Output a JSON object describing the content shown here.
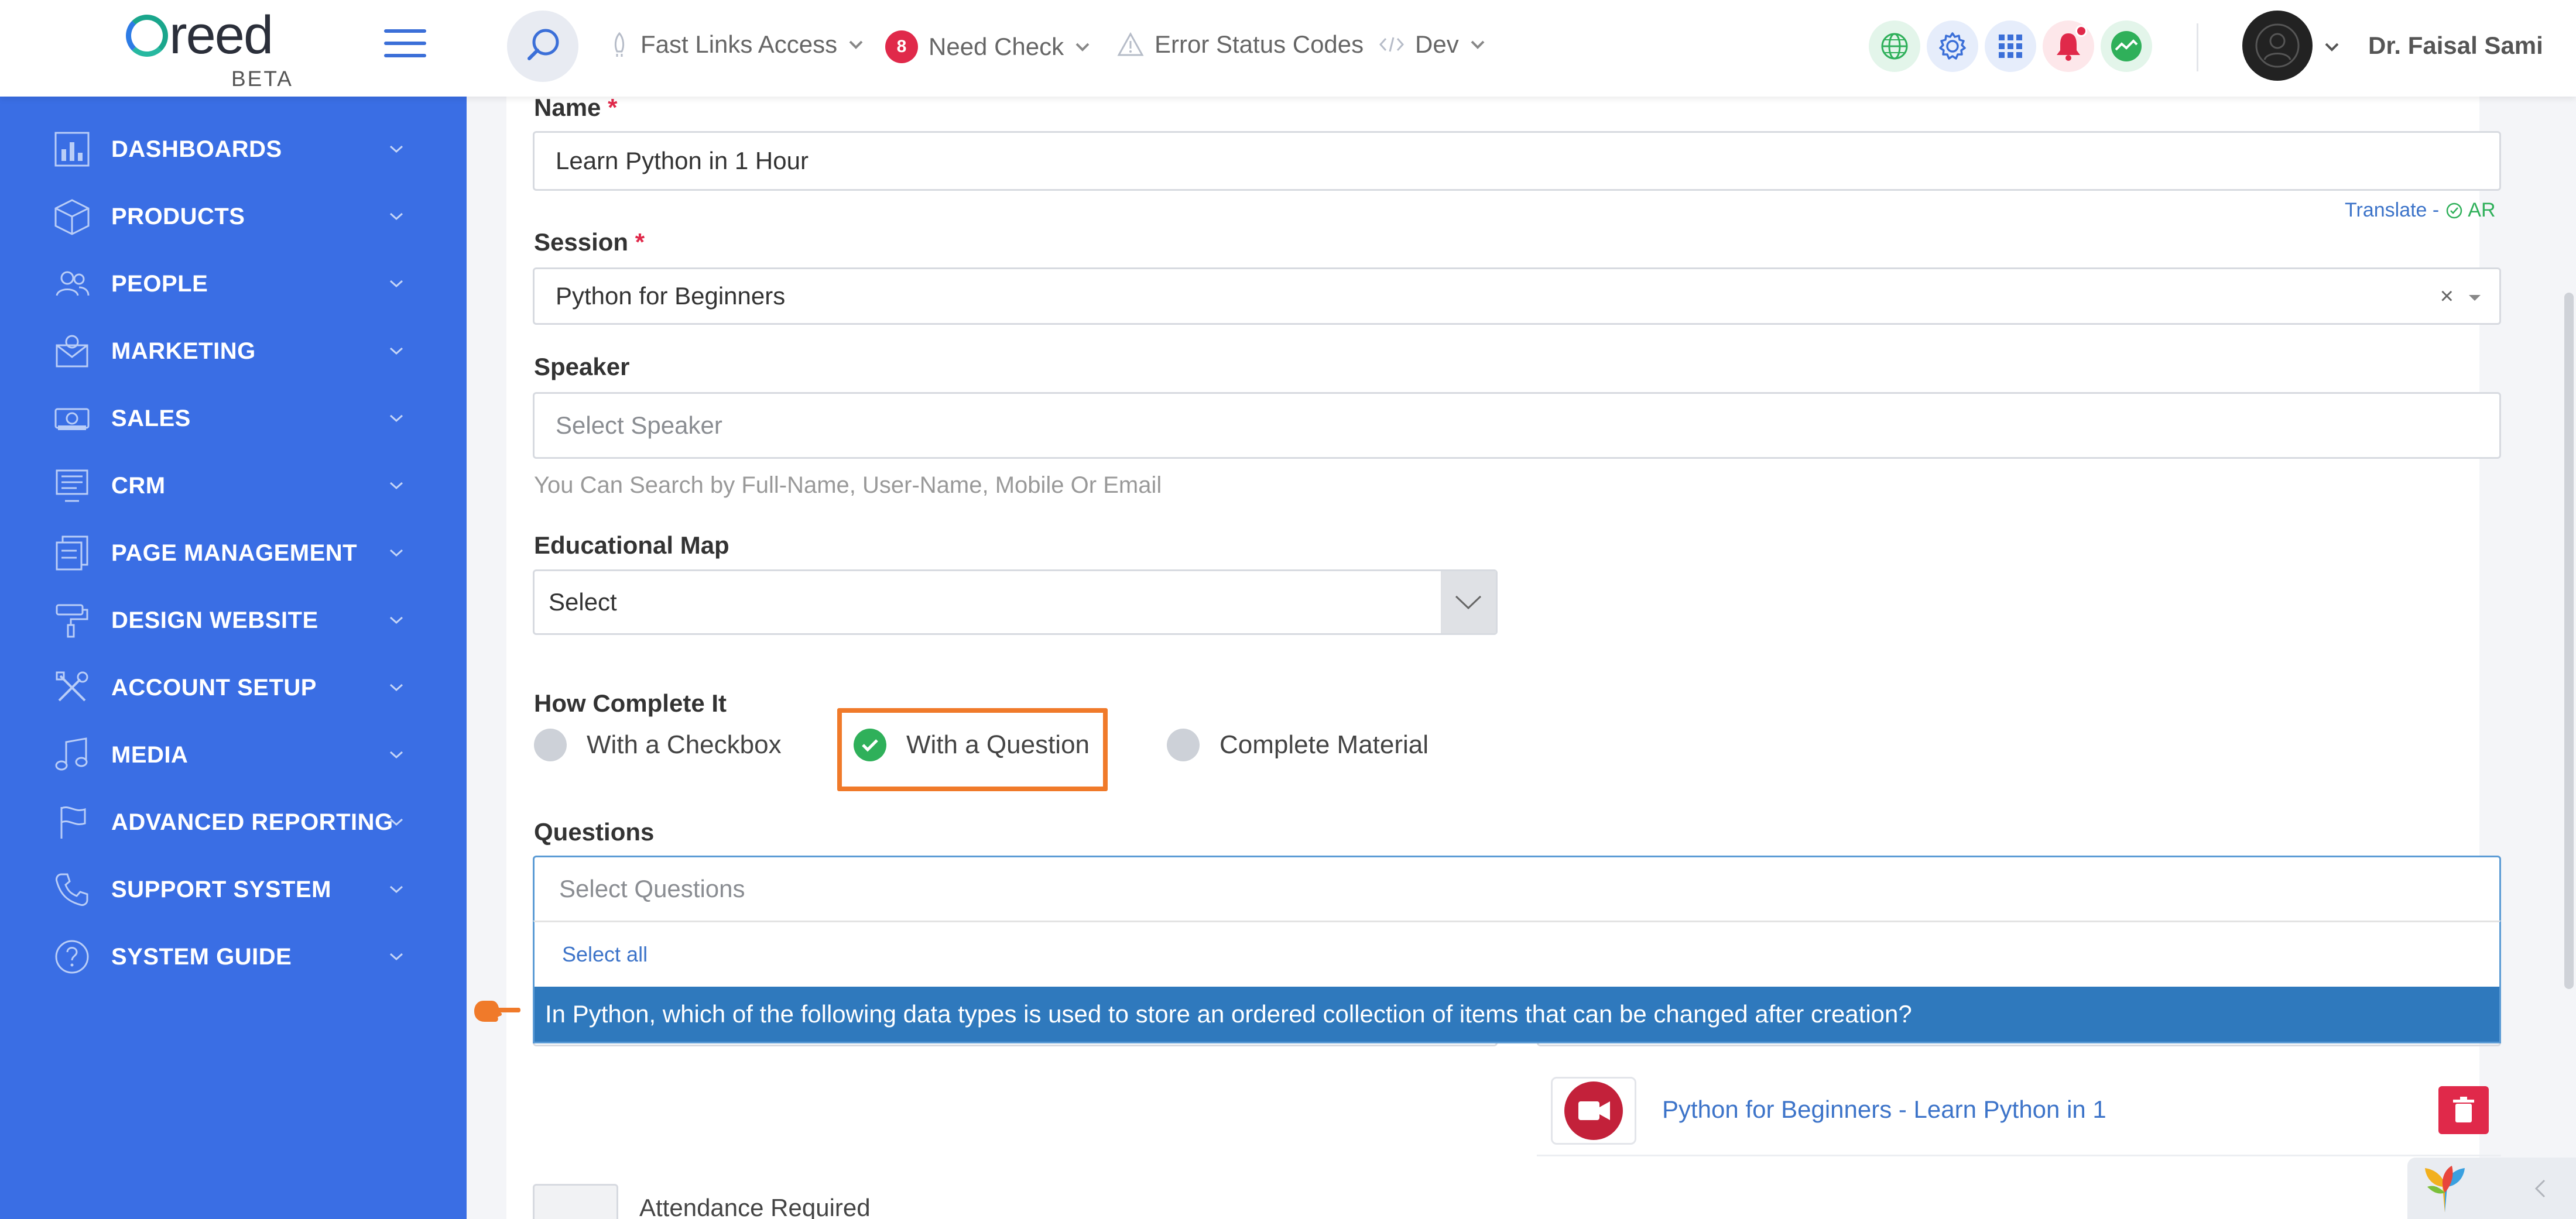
{
  "header": {
    "logo_text": "reed",
    "logo_badge": "BETA",
    "nav": {
      "fast_links": "Fast Links Access",
      "need_check_count": "8",
      "need_check": "Need Check",
      "error_codes": "Error Status Codes",
      "dev": "Dev"
    },
    "user_name": "Dr. Faisal Sami"
  },
  "sidebar": {
    "items": [
      {
        "label": "DASHBOARDS",
        "icon": "bar-chart-icon"
      },
      {
        "label": "PRODUCTS",
        "icon": "box-icon"
      },
      {
        "label": "PEOPLE",
        "icon": "people-icon"
      },
      {
        "label": "MARKETING",
        "icon": "megaphone-icon"
      },
      {
        "label": "SALES",
        "icon": "money-icon"
      },
      {
        "label": "CRM",
        "icon": "monitor-icon"
      },
      {
        "label": "PAGE MANAGEMENT",
        "icon": "pages-icon"
      },
      {
        "label": "DESIGN WEBSITE",
        "icon": "paint-roller-icon"
      },
      {
        "label": "ACCOUNT SETUP",
        "icon": "tools-icon"
      },
      {
        "label": "MEDIA",
        "icon": "music-note-icon"
      },
      {
        "label": "ADVANCED REPORTING",
        "icon": "flag-icon"
      },
      {
        "label": "SUPPORT SYSTEM",
        "icon": "phone-icon"
      },
      {
        "label": "SYSTEM GUIDE",
        "icon": "question-icon"
      }
    ]
  },
  "form": {
    "name_label": "Name",
    "required_mark": "*",
    "name_value": "Learn Python in 1 Hour",
    "translate_label": "Translate -",
    "translate_lang": "AR",
    "session_label": "Session",
    "session_value": "Python for Beginners",
    "speaker_label": "Speaker",
    "speaker_placeholder": "Select Speaker",
    "speaker_help": "You Can Search by Full-Name, User-Name, Mobile Or Email",
    "edu_map_label": "Educational Map",
    "edu_map_value": "Select",
    "how_complete_label": "How Complete It",
    "options": {
      "checkbox": "With a Checkbox",
      "question": "With a Question",
      "material": "Complete Material"
    },
    "questions_label": "Questions",
    "questions_placeholder": "Select Questions",
    "select_all": "Select all",
    "question_option": "In Python, which of the following data types is used to store an ordered collection of items that can be changed after creation?",
    "attached_material": "Python for Beginners - Learn Python in 1",
    "attendance_label": "Attendance Required"
  }
}
